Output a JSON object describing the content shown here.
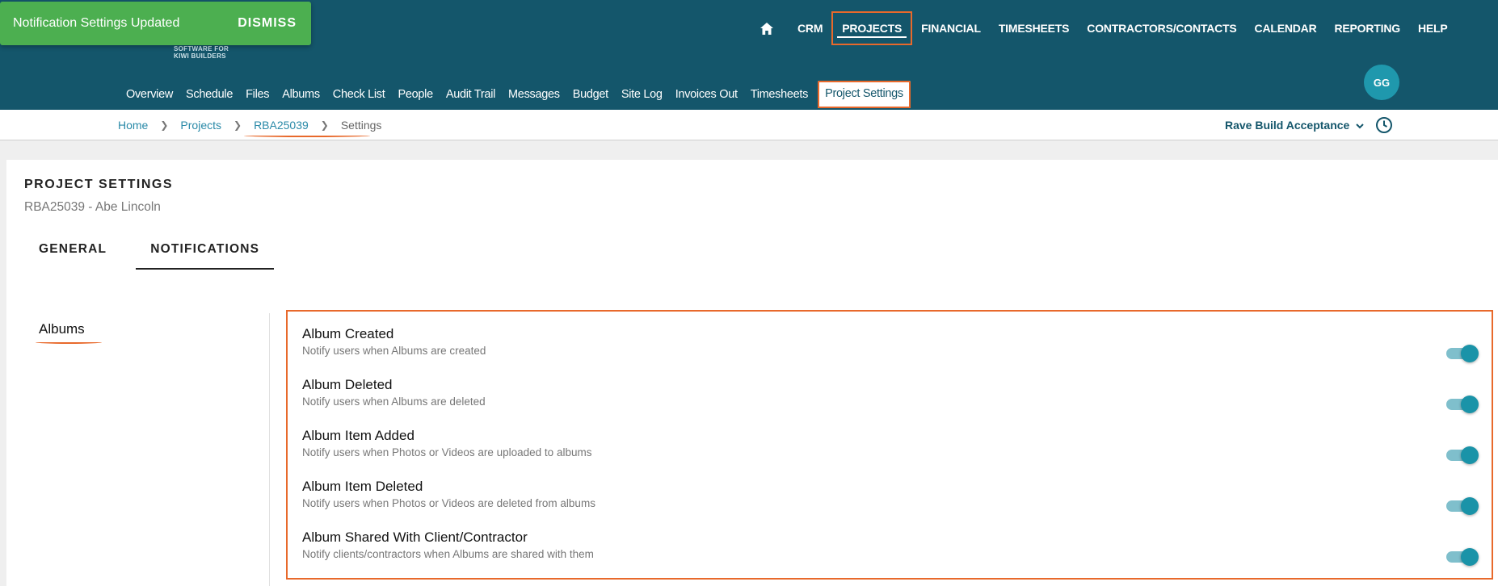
{
  "brand": {
    "tagline_line1": "SOFTWARE FOR",
    "tagline_line2": "KIWI BUILDERS"
  },
  "toast": {
    "message": "Notification Settings Updated",
    "action": "DISMISS",
    "color": "#4caf50"
  },
  "topnav": {
    "home_icon": "home-icon",
    "items": [
      "CRM",
      "PROJECTS",
      "FINANCIAL",
      "TIMESHEETS",
      "CONTRACTORS/CONTACTS",
      "CALENDAR",
      "REPORTING",
      "HELP"
    ],
    "active": "PROJECTS"
  },
  "subnav": {
    "items": [
      "Overview",
      "Schedule",
      "Files",
      "Albums",
      "Check List",
      "People",
      "Audit Trail",
      "Messages",
      "Budget",
      "Site Log",
      "Invoices Out",
      "Timesheets",
      "Project Settings"
    ],
    "active": "Project Settings"
  },
  "user": {
    "initials": "GG"
  },
  "breadcrumb": {
    "home": "Home",
    "projects": "Projects",
    "project": "RBA25039",
    "current": "Settings"
  },
  "project_selector": {
    "label": "Rave Build Acceptance"
  },
  "page": {
    "title": "PROJECT SETTINGS",
    "subtitle": "RBA25039 - Abe Lincoln",
    "tabs": [
      "GENERAL",
      "NOTIFICATIONS"
    ],
    "active_tab": "NOTIFICATIONS"
  },
  "sidebar": {
    "items": [
      "Albums"
    ]
  },
  "settings": [
    {
      "name": "Album Created",
      "desc": "Notify users when Albums are created",
      "enabled": true
    },
    {
      "name": "Album Deleted",
      "desc": "Notify users when Albums are deleted",
      "enabled": true
    },
    {
      "name": "Album Item Added",
      "desc": "Notify users when Photos or Videos are uploaded to albums",
      "enabled": true
    },
    {
      "name": "Album Item Deleted",
      "desc": "Notify users when Photos or Videos are deleted from albums",
      "enabled": true
    },
    {
      "name": "Album Shared With Client/Contractor",
      "desc": "Notify clients/contractors when Albums are shared with them",
      "enabled": true
    }
  ],
  "colors": {
    "header": "#14566b",
    "accent": "#1a93a8",
    "highlight": "#e8692b"
  }
}
